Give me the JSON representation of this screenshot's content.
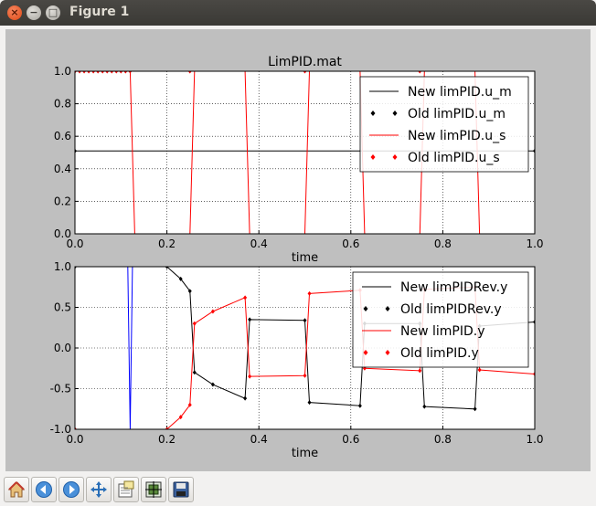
{
  "window": {
    "title": "Figure 1",
    "close_glyph": "×",
    "minimize_glyph": "−",
    "maximize_glyph": "□"
  },
  "toolbar": {
    "buttons": [
      {
        "name": "home-icon"
      },
      {
        "name": "back-arrow-icon"
      },
      {
        "name": "forward-arrow-icon"
      },
      {
        "name": "pan-icon"
      },
      {
        "name": "zoom-to-rect-icon"
      },
      {
        "name": "subplots-config-icon"
      },
      {
        "name": "save-icon"
      }
    ]
  },
  "colors": {
    "black": "#000000",
    "red": "#ff0000",
    "blue": "#0000ff",
    "canvas_bg": "#bfbfbf"
  },
  "chart_data": [
    {
      "type": "line",
      "title": "LimPID.mat",
      "xlabel": "time",
      "ylabel": "",
      "xlim": [
        0,
        1
      ],
      "ylim": [
        0,
        1
      ],
      "xticks": [
        "0.0",
        "0.2",
        "0.4",
        "0.6",
        "0.8",
        "1.0"
      ],
      "yticks": [
        "0.0",
        "0.2",
        "0.4",
        "0.6",
        "0.8",
        "1.0"
      ],
      "grid": true,
      "legend_position": "top-right",
      "series": [
        {
          "name": "New limPID.u_m",
          "color": "#000000",
          "style": "line",
          "x": [
            0,
            1
          ],
          "y": [
            0.51,
            0.51
          ]
        },
        {
          "name": "Old limPID.u_m",
          "color": "#000000",
          "style": "markers",
          "x": [
            0,
            1
          ],
          "y": [
            0.51,
            0.51
          ]
        },
        {
          "name": "New limPID.u_s",
          "color": "#ff0000",
          "style": "line",
          "x": [
            0,
            0.12,
            0.13,
            0.25,
            0.26,
            0.37,
            0.38,
            0.5,
            0.51,
            0.62,
            0.63,
            0.75,
            0.76,
            0.87,
            0.88,
            1.0
          ],
          "y": [
            1,
            1,
            0,
            0,
            1,
            1,
            0,
            0,
            1,
            1,
            0,
            0,
            1,
            1,
            0,
            0
          ]
        },
        {
          "name": "Old limPID.u_s",
          "color": "#ff0000",
          "style": "markers",
          "x": [
            0,
            0.01,
            0.02,
            0.03,
            0.04,
            0.05,
            0.06,
            0.07,
            0.08,
            0.09,
            0.1,
            0.11,
            0.12,
            0.25,
            0.5,
            0.75
          ],
          "y": [
            1,
            1,
            1,
            1,
            1,
            1,
            1,
            1,
            1,
            1,
            1,
            1,
            1,
            1,
            1,
            1
          ]
        }
      ]
    },
    {
      "type": "line",
      "title": "",
      "xlabel": "time",
      "ylabel": "",
      "xlim": [
        0,
        1
      ],
      "ylim": [
        -1,
        1
      ],
      "xticks": [
        "0.0",
        "0.2",
        "0.4",
        "0.6",
        "0.8",
        "1.0"
      ],
      "yticks": [
        "-1.0",
        "-0.5",
        "0.0",
        "0.5",
        "1.0"
      ],
      "grid": true,
      "legend_position": "top-right",
      "series": [
        {
          "name": "New limPIDRev.y",
          "color": "#000000",
          "style": "line",
          "x": [
            0,
            0.2,
            0.23,
            0.25,
            0.26,
            0.3,
            0.37,
            0.38,
            0.5,
            0.51,
            0.62,
            0.63,
            0.75,
            0.76,
            0.87,
            0.88,
            1.0
          ],
          "y": [
            1,
            1,
            0.85,
            0.7,
            -0.3,
            -0.45,
            -0.62,
            0.35,
            0.34,
            -0.67,
            -0.71,
            0.3,
            0.3,
            -0.72,
            -0.75,
            0.27,
            0.32
          ]
        },
        {
          "name": "Old limPIDRev.y",
          "color": "#000000",
          "style": "markers",
          "x": [
            0,
            0.2,
            0.23,
            0.25,
            0.26,
            0.3,
            0.37,
            0.38,
            0.5,
            0.51,
            0.62,
            0.63,
            0.75,
            0.76,
            0.87,
            0.88,
            1.0
          ],
          "y": [
            1,
            1,
            0.85,
            0.7,
            -0.3,
            -0.45,
            -0.62,
            0.35,
            0.34,
            -0.67,
            -0.71,
            0.3,
            0.3,
            -0.72,
            -0.75,
            0.27,
            0.32
          ]
        },
        {
          "name": "New limPID.y",
          "color": "#ff0000",
          "style": "line",
          "x": [
            0,
            0.2,
            0.23,
            0.25,
            0.26,
            0.3,
            0.37,
            0.38,
            0.5,
            0.51,
            0.62,
            0.63,
            0.75,
            0.76,
            0.87,
            0.88,
            1.0
          ],
          "y": [
            -1,
            -1,
            -0.85,
            -0.7,
            0.3,
            0.45,
            0.62,
            -0.35,
            -0.34,
            0.67,
            0.71,
            -0.25,
            -0.28,
            0.72,
            0.75,
            -0.27,
            -0.32
          ]
        },
        {
          "name": "Old limPID.y",
          "color": "#ff0000",
          "style": "markers",
          "x": [
            0,
            0.2,
            0.23,
            0.25,
            0.26,
            0.3,
            0.37,
            0.38,
            0.5,
            0.51,
            0.62,
            0.63,
            0.75,
            0.76,
            0.87,
            0.88,
            1.0
          ],
          "y": [
            -1,
            -1,
            -0.85,
            -0.7,
            0.3,
            0.45,
            0.62,
            -0.35,
            -0.34,
            0.67,
            0.71,
            -0.25,
            -0.28,
            0.72,
            0.75,
            -0.27,
            -0.32
          ]
        },
        {
          "name": "",
          "color": "#0000ff",
          "style": "line",
          "x": [
            0.115,
            0.12,
            0.125
          ],
          "y": [
            1,
            -1,
            1
          ]
        }
      ]
    }
  ]
}
